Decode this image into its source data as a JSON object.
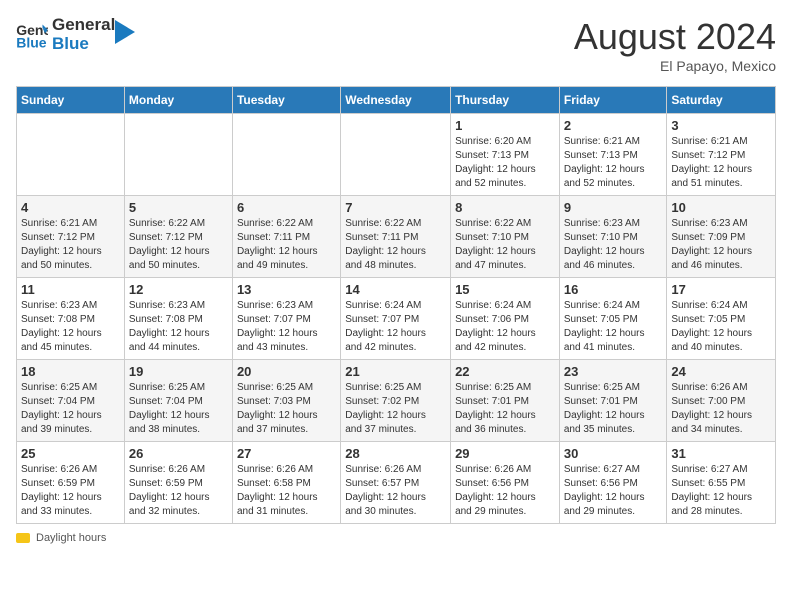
{
  "header": {
    "logo_general": "General",
    "logo_blue": "Blue",
    "month_title": "August 2024",
    "location": "El Papayo, Mexico"
  },
  "footer": {
    "label": "Daylight hours"
  },
  "weekdays": [
    "Sunday",
    "Monday",
    "Tuesday",
    "Wednesday",
    "Thursday",
    "Friday",
    "Saturday"
  ],
  "weeks": [
    [
      {
        "day": "",
        "info": ""
      },
      {
        "day": "",
        "info": ""
      },
      {
        "day": "",
        "info": ""
      },
      {
        "day": "",
        "info": ""
      },
      {
        "day": "1",
        "info": "Sunrise: 6:20 AM\nSunset: 7:13 PM\nDaylight: 12 hours\nand 52 minutes."
      },
      {
        "day": "2",
        "info": "Sunrise: 6:21 AM\nSunset: 7:13 PM\nDaylight: 12 hours\nand 52 minutes."
      },
      {
        "day": "3",
        "info": "Sunrise: 6:21 AM\nSunset: 7:12 PM\nDaylight: 12 hours\nand 51 minutes."
      }
    ],
    [
      {
        "day": "4",
        "info": "Sunrise: 6:21 AM\nSunset: 7:12 PM\nDaylight: 12 hours\nand 50 minutes."
      },
      {
        "day": "5",
        "info": "Sunrise: 6:22 AM\nSunset: 7:12 PM\nDaylight: 12 hours\nand 50 minutes."
      },
      {
        "day": "6",
        "info": "Sunrise: 6:22 AM\nSunset: 7:11 PM\nDaylight: 12 hours\nand 49 minutes."
      },
      {
        "day": "7",
        "info": "Sunrise: 6:22 AM\nSunset: 7:11 PM\nDaylight: 12 hours\nand 48 minutes."
      },
      {
        "day": "8",
        "info": "Sunrise: 6:22 AM\nSunset: 7:10 PM\nDaylight: 12 hours\nand 47 minutes."
      },
      {
        "day": "9",
        "info": "Sunrise: 6:23 AM\nSunset: 7:10 PM\nDaylight: 12 hours\nand 46 minutes."
      },
      {
        "day": "10",
        "info": "Sunrise: 6:23 AM\nSunset: 7:09 PM\nDaylight: 12 hours\nand 46 minutes."
      }
    ],
    [
      {
        "day": "11",
        "info": "Sunrise: 6:23 AM\nSunset: 7:08 PM\nDaylight: 12 hours\nand 45 minutes."
      },
      {
        "day": "12",
        "info": "Sunrise: 6:23 AM\nSunset: 7:08 PM\nDaylight: 12 hours\nand 44 minutes."
      },
      {
        "day": "13",
        "info": "Sunrise: 6:23 AM\nSunset: 7:07 PM\nDaylight: 12 hours\nand 43 minutes."
      },
      {
        "day": "14",
        "info": "Sunrise: 6:24 AM\nSunset: 7:07 PM\nDaylight: 12 hours\nand 42 minutes."
      },
      {
        "day": "15",
        "info": "Sunrise: 6:24 AM\nSunset: 7:06 PM\nDaylight: 12 hours\nand 42 minutes."
      },
      {
        "day": "16",
        "info": "Sunrise: 6:24 AM\nSunset: 7:05 PM\nDaylight: 12 hours\nand 41 minutes."
      },
      {
        "day": "17",
        "info": "Sunrise: 6:24 AM\nSunset: 7:05 PM\nDaylight: 12 hours\nand 40 minutes."
      }
    ],
    [
      {
        "day": "18",
        "info": "Sunrise: 6:25 AM\nSunset: 7:04 PM\nDaylight: 12 hours\nand 39 minutes."
      },
      {
        "day": "19",
        "info": "Sunrise: 6:25 AM\nSunset: 7:04 PM\nDaylight: 12 hours\nand 38 minutes."
      },
      {
        "day": "20",
        "info": "Sunrise: 6:25 AM\nSunset: 7:03 PM\nDaylight: 12 hours\nand 37 minutes."
      },
      {
        "day": "21",
        "info": "Sunrise: 6:25 AM\nSunset: 7:02 PM\nDaylight: 12 hours\nand 37 minutes."
      },
      {
        "day": "22",
        "info": "Sunrise: 6:25 AM\nSunset: 7:01 PM\nDaylight: 12 hours\nand 36 minutes."
      },
      {
        "day": "23",
        "info": "Sunrise: 6:25 AM\nSunset: 7:01 PM\nDaylight: 12 hours\nand 35 minutes."
      },
      {
        "day": "24",
        "info": "Sunrise: 6:26 AM\nSunset: 7:00 PM\nDaylight: 12 hours\nand 34 minutes."
      }
    ],
    [
      {
        "day": "25",
        "info": "Sunrise: 6:26 AM\nSunset: 6:59 PM\nDaylight: 12 hours\nand 33 minutes."
      },
      {
        "day": "26",
        "info": "Sunrise: 6:26 AM\nSunset: 6:59 PM\nDaylight: 12 hours\nand 32 minutes."
      },
      {
        "day": "27",
        "info": "Sunrise: 6:26 AM\nSunset: 6:58 PM\nDaylight: 12 hours\nand 31 minutes."
      },
      {
        "day": "28",
        "info": "Sunrise: 6:26 AM\nSunset: 6:57 PM\nDaylight: 12 hours\nand 30 minutes."
      },
      {
        "day": "29",
        "info": "Sunrise: 6:26 AM\nSunset: 6:56 PM\nDaylight: 12 hours\nand 29 minutes."
      },
      {
        "day": "30",
        "info": "Sunrise: 6:27 AM\nSunset: 6:56 PM\nDaylight: 12 hours\nand 29 minutes."
      },
      {
        "day": "31",
        "info": "Sunrise: 6:27 AM\nSunset: 6:55 PM\nDaylight: 12 hours\nand 28 minutes."
      }
    ]
  ]
}
